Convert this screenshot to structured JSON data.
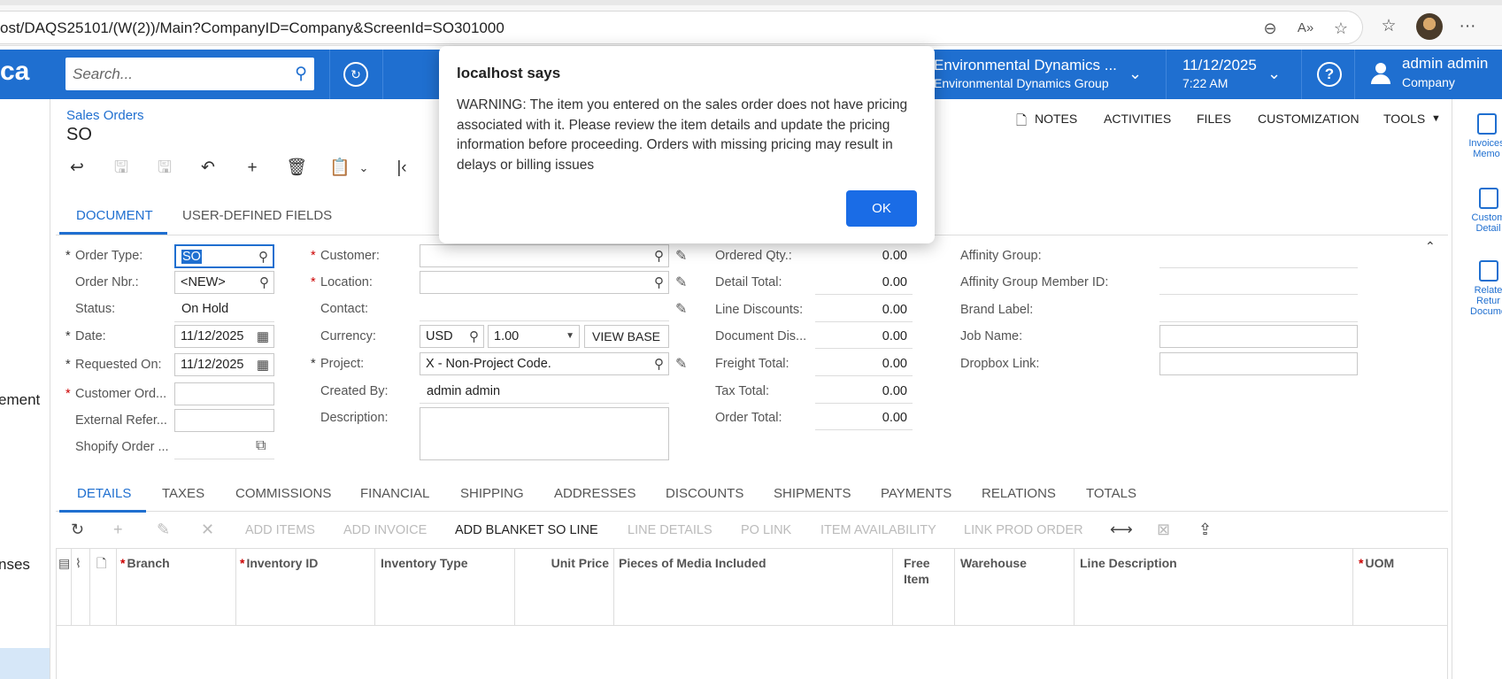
{
  "browser": {
    "url": "ost/DAQS25101/(W(2))/Main?CompanyID=Company&ScreenId=SO301000",
    "icons": [
      "zoom-out-icon",
      "read-aloud-icon",
      "favorite-star-icon",
      "favorites-list-icon",
      "profile-avatar",
      "more-icon"
    ]
  },
  "header": {
    "logo": "ca",
    "search_placeholder": "Search...",
    "company_line1": "Environmental Dynamics ...",
    "company_line2": "Environmental Dynamics Group",
    "date_line1": "11/12/2025",
    "date_line2": "7:22 AM",
    "user_line1": "admin admin",
    "user_line2": "Company",
    "accent_color": "#1f6fd0"
  },
  "sidebar": {
    "items": [
      "ement",
      "nses"
    ]
  },
  "right_sidebar": {
    "items": [
      {
        "line1": "Invoices",
        "line2": "Memo"
      },
      {
        "line1": "Custom",
        "line2": "Detail"
      },
      {
        "line1": "Relate",
        "line2": "Retur",
        "line3": "Docume"
      }
    ]
  },
  "page": {
    "breadcrumb": "Sales Orders",
    "title": "SO",
    "actions": [
      "NOTES",
      "ACTIVITIES",
      "FILES",
      "CUSTOMIZATION",
      "TOOLS"
    ]
  },
  "form_tabs": [
    "DOCUMENT",
    "USER-DEFINED FIELDS"
  ],
  "form": {
    "order_type_label": "Order Type:",
    "order_type_value": "SO",
    "order_nbr_label": "Order Nbr.:",
    "order_nbr_value": "<NEW>",
    "status_label": "Status:",
    "status_value": "On Hold",
    "date_label": "Date:",
    "date_value": "11/12/2025",
    "requested_on_label": "Requested On:",
    "requested_on_value": "11/12/2025",
    "customer_ord_label": "Customer Ord...",
    "external_ref_label": "External Refer...",
    "shopify_label": "Shopify Order ...",
    "customer_label": "Customer:",
    "location_label": "Location:",
    "contact_label": "Contact:",
    "currency_label": "Currency:",
    "currency_value": "USD",
    "rate_value": "1.00",
    "view_base": "VIEW BASE",
    "project_label": "Project:",
    "project_value": "X - Non-Project Code.",
    "created_by_label": "Created By:",
    "created_by_value": "admin admin",
    "description_label": "Description:",
    "ordered_qty_label": "Ordered Qty.:",
    "ordered_qty_value": "0.00",
    "detail_total_label": "Detail Total:",
    "detail_total_value": "0.00",
    "line_discounts_label": "Line Discounts:",
    "line_discounts_value": "0.00",
    "document_dis_label": "Document Dis...",
    "document_dis_value": "0.00",
    "freight_total_label": "Freight Total:",
    "freight_total_value": "0.00",
    "tax_total_label": "Tax Total:",
    "tax_total_value": "0.00",
    "order_total_label": "Order Total:",
    "order_total_value": "0.00",
    "affinity_group_label": "Affinity Group:",
    "affinity_member_label": "Affinity Group Member ID:",
    "brand_label_label": "Brand Label:",
    "job_name_label": "Job Name:",
    "dropbox_link_label": "Dropbox Link:"
  },
  "detail_tabs": [
    "DETAILS",
    "TAXES",
    "COMMISSIONS",
    "FINANCIAL",
    "SHIPPING",
    "ADDRESSES",
    "DISCOUNTS",
    "SHIPMENTS",
    "PAYMENTS",
    "RELATIONS",
    "TOTALS"
  ],
  "grid_toolbar": {
    "add_items": "ADD ITEMS",
    "add_invoice": "ADD INVOICE",
    "add_blanket": "ADD BLANKET SO LINE",
    "line_details": "LINE DETAILS",
    "po_link": "PO LINK",
    "item_availability": "ITEM AVAILABILITY",
    "link_prod_order": "LINK PROD ORDER"
  },
  "grid_columns": {
    "branch": "Branch",
    "inventory_id": "Inventory ID",
    "inventory_type": "Inventory Type",
    "unit_price": "Unit Price",
    "pieces_media": "Pieces of Media Included",
    "free_item_1": "Free",
    "free_item_2": "Item",
    "warehouse": "Warehouse",
    "line_description": "Line Description",
    "uom": "UOM"
  },
  "dialog": {
    "title": "localhost says",
    "message": "WARNING: The item you entered on the sales order does not have pricing associated with it. Please review the item details and update the pricing information before proceeding. Orders with missing pricing may result in delays or billing issues",
    "ok": "OK",
    "button_color": "#1a6ce6"
  }
}
